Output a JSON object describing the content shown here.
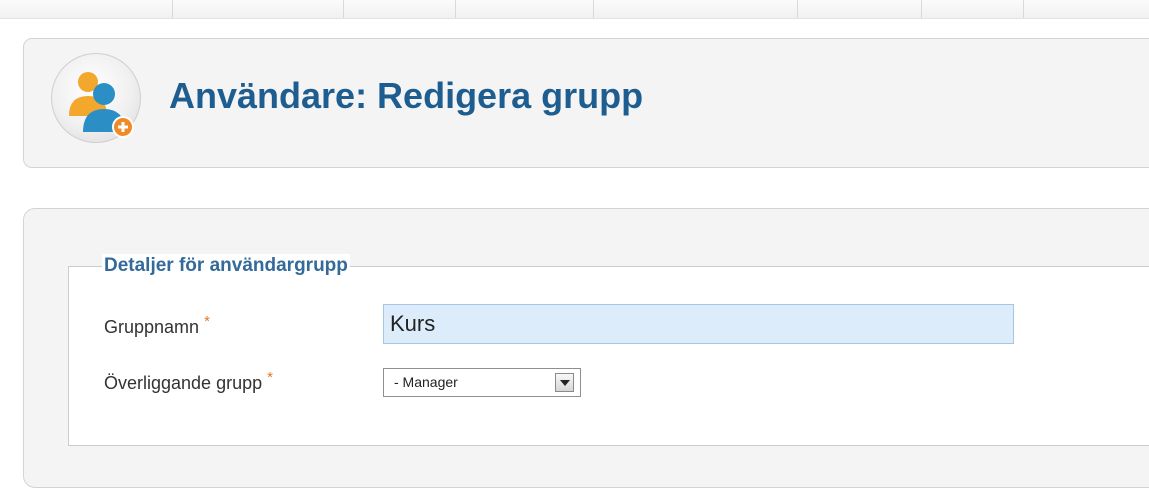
{
  "header": {
    "title": "Användare: Redigera grupp",
    "icon": "user-group-add-icon"
  },
  "form": {
    "legend": "Detaljer för användargrupp",
    "group_name": {
      "label": "Gruppnamn",
      "required_mark": "*",
      "value": "Kurs"
    },
    "parent_group": {
      "label": "Överliggande grupp",
      "required_mark": "*",
      "selected": "- Manager"
    }
  },
  "colors": {
    "title": "#1e5d8f",
    "legend": "#336a99",
    "required": "#e07b2a",
    "input_background": "#dcecfa"
  }
}
